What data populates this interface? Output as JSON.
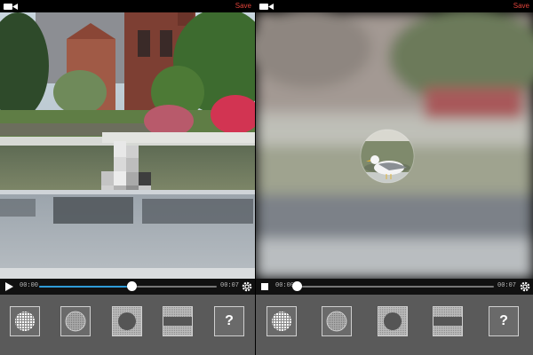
{
  "left_panel": {
    "save_label": "Save",
    "video": {
      "subject": "park fountain with pixelated post",
      "effect": "pixelate"
    },
    "controls": {
      "play_icon": "play-icon",
      "time_start": "00:00",
      "time_end": "00:07",
      "progress": 0.52,
      "settings_icon": "gear-icon"
    },
    "tools": [
      {
        "icon": "grid-circle-icon"
      },
      {
        "icon": "blur-circle-icon"
      },
      {
        "icon": "dark-circle-icon"
      },
      {
        "icon": "band-filter-icon"
      },
      {
        "icon": "help-icon",
        "glyph": "?"
      }
    ]
  },
  "right_panel": {
    "save_label": "Save",
    "video": {
      "subject": "seagull in focus circle",
      "effect": "blur-outside-circle"
    },
    "controls": {
      "pause_icon": "pause-icon",
      "time_start": "00:00",
      "time_end": "00:07",
      "progress": 0.0,
      "settings_icon": "gear-icon"
    },
    "tools": [
      {
        "icon": "grid-circle-icon"
      },
      {
        "icon": "blur-circle-icon"
      },
      {
        "icon": "dark-circle-icon"
      },
      {
        "icon": "band-filter-icon"
      },
      {
        "icon": "help-icon",
        "glyph": "?"
      }
    ]
  },
  "colors": {
    "save": "#e0433a",
    "progress_fill": "#2f9bd8",
    "toolbar_bg": "#5a5a5a"
  }
}
